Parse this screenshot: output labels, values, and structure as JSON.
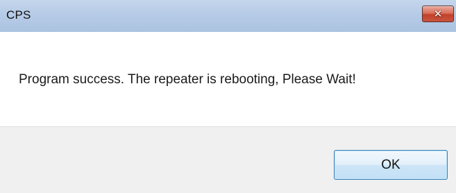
{
  "window": {
    "title": "CPS",
    "close_icon": "close-icon",
    "close_glyph": "✕"
  },
  "dialog": {
    "message": "Program success. The repeater is rebooting, Please Wait!",
    "ok_label": "OK"
  },
  "colors": {
    "titlebar": "#b6cbe6",
    "close_button": "#c8553e",
    "footer": "#f0f0f0",
    "ok_border": "#3c7fb1"
  }
}
